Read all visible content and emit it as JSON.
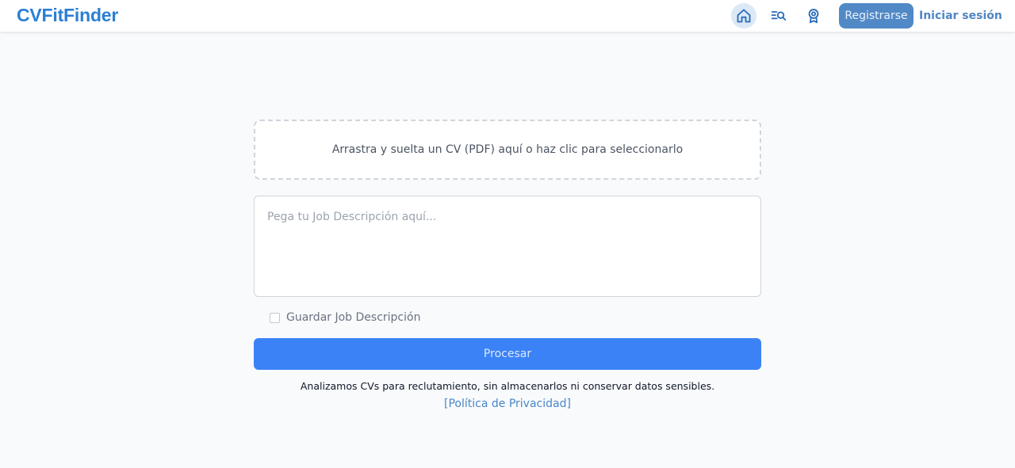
{
  "colors": {
    "brand": "#2b7fd4",
    "primary_button": "#3b82f6",
    "register_button": "#5189c6",
    "link": "#4a86c8",
    "page_background": "#f8fafc"
  },
  "header": {
    "logo": "CVFitFinder",
    "icons": [
      "home-icon",
      "search-list-icon",
      "award-icon"
    ],
    "register_label": "Registrarse",
    "login_label": "Iniciar sesión"
  },
  "upload": {
    "dropzone_text": "Arrastra y suelta un CV (PDF) aquí o haz clic para seleccionarlo"
  },
  "job_description": {
    "placeholder": "Pega tu Job Descripción aquí...",
    "value": ""
  },
  "save_option": {
    "label": "Guardar Job Descripción",
    "checked": false
  },
  "process_label": "Procesar",
  "footer": {
    "notice": "Analizamos CVs para reclutamiento, sin almacenarlos ni conservar datos sensibles.",
    "privacy_link": "[Política de Privacidad]"
  }
}
